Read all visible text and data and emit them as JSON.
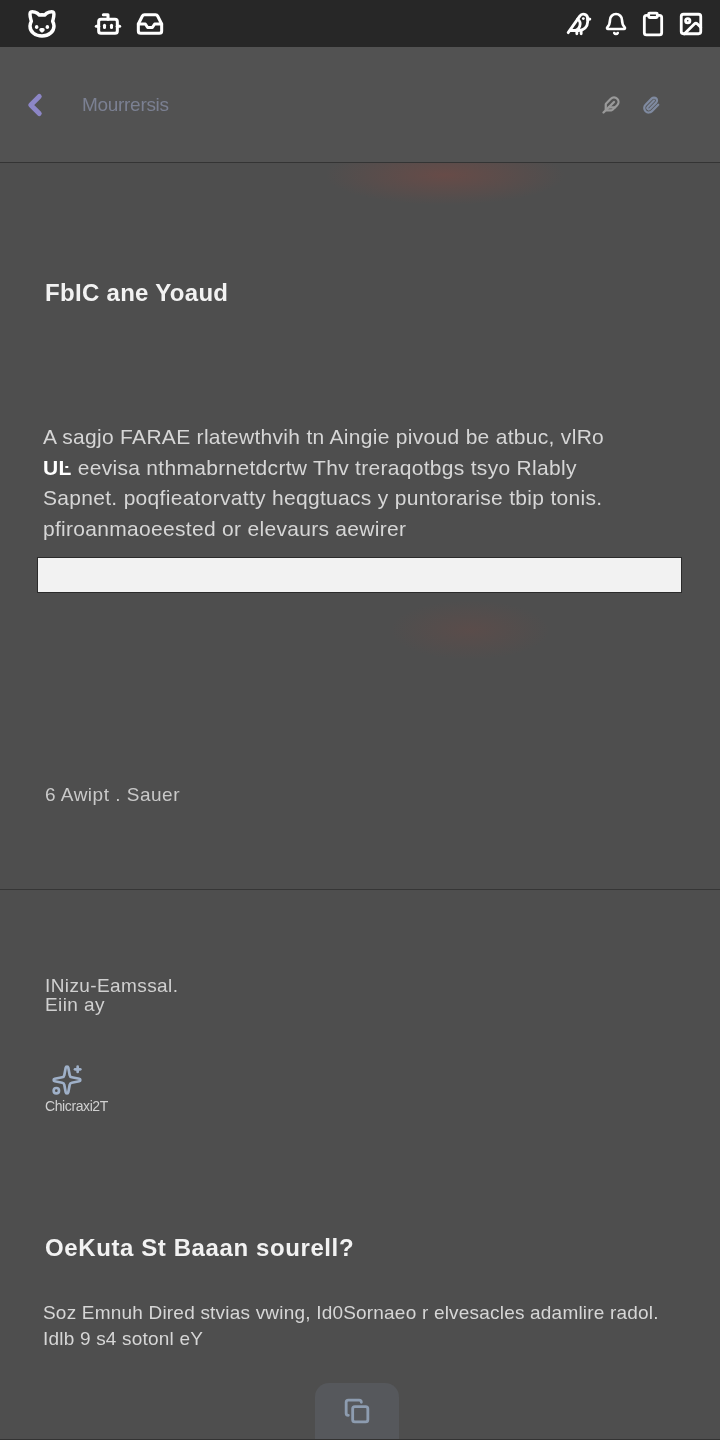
{
  "app_bar": {
    "title": "Mourrersis"
  },
  "section_1": {
    "heading": "FbIC ane Yoaud",
    "paragraph": [
      "A sagjo FARAE rlatewthvih tn Aingie pivoud be atbuc, vlRo",
      "**UĿ** eevisa nthmabrnetdcrtw Thv treraqotbgs tsyo Rlably",
      "Sapnet. poqfieatorvatty heqgtuacs y puntorarise tbip tonis.",
      "pfiroanmaoeested or elevaurs aewirer"
    ],
    "note": "6 Awipt . Sauer"
  },
  "section_2": {
    "label_lines": [
      "INizu-Eamssal.",
      "Eiin ay"
    ],
    "icon_caption": "Chicraxi2T"
  },
  "section_3": {
    "heading": "OeKuta St Baaan sourell?",
    "paragraph": [
      "Soz Emnuh Dired stvias vwing, Id0Sornaeo r elvesacles adamlire radol.",
      "Idlb 9 s4 sotonl eY"
    ]
  }
}
